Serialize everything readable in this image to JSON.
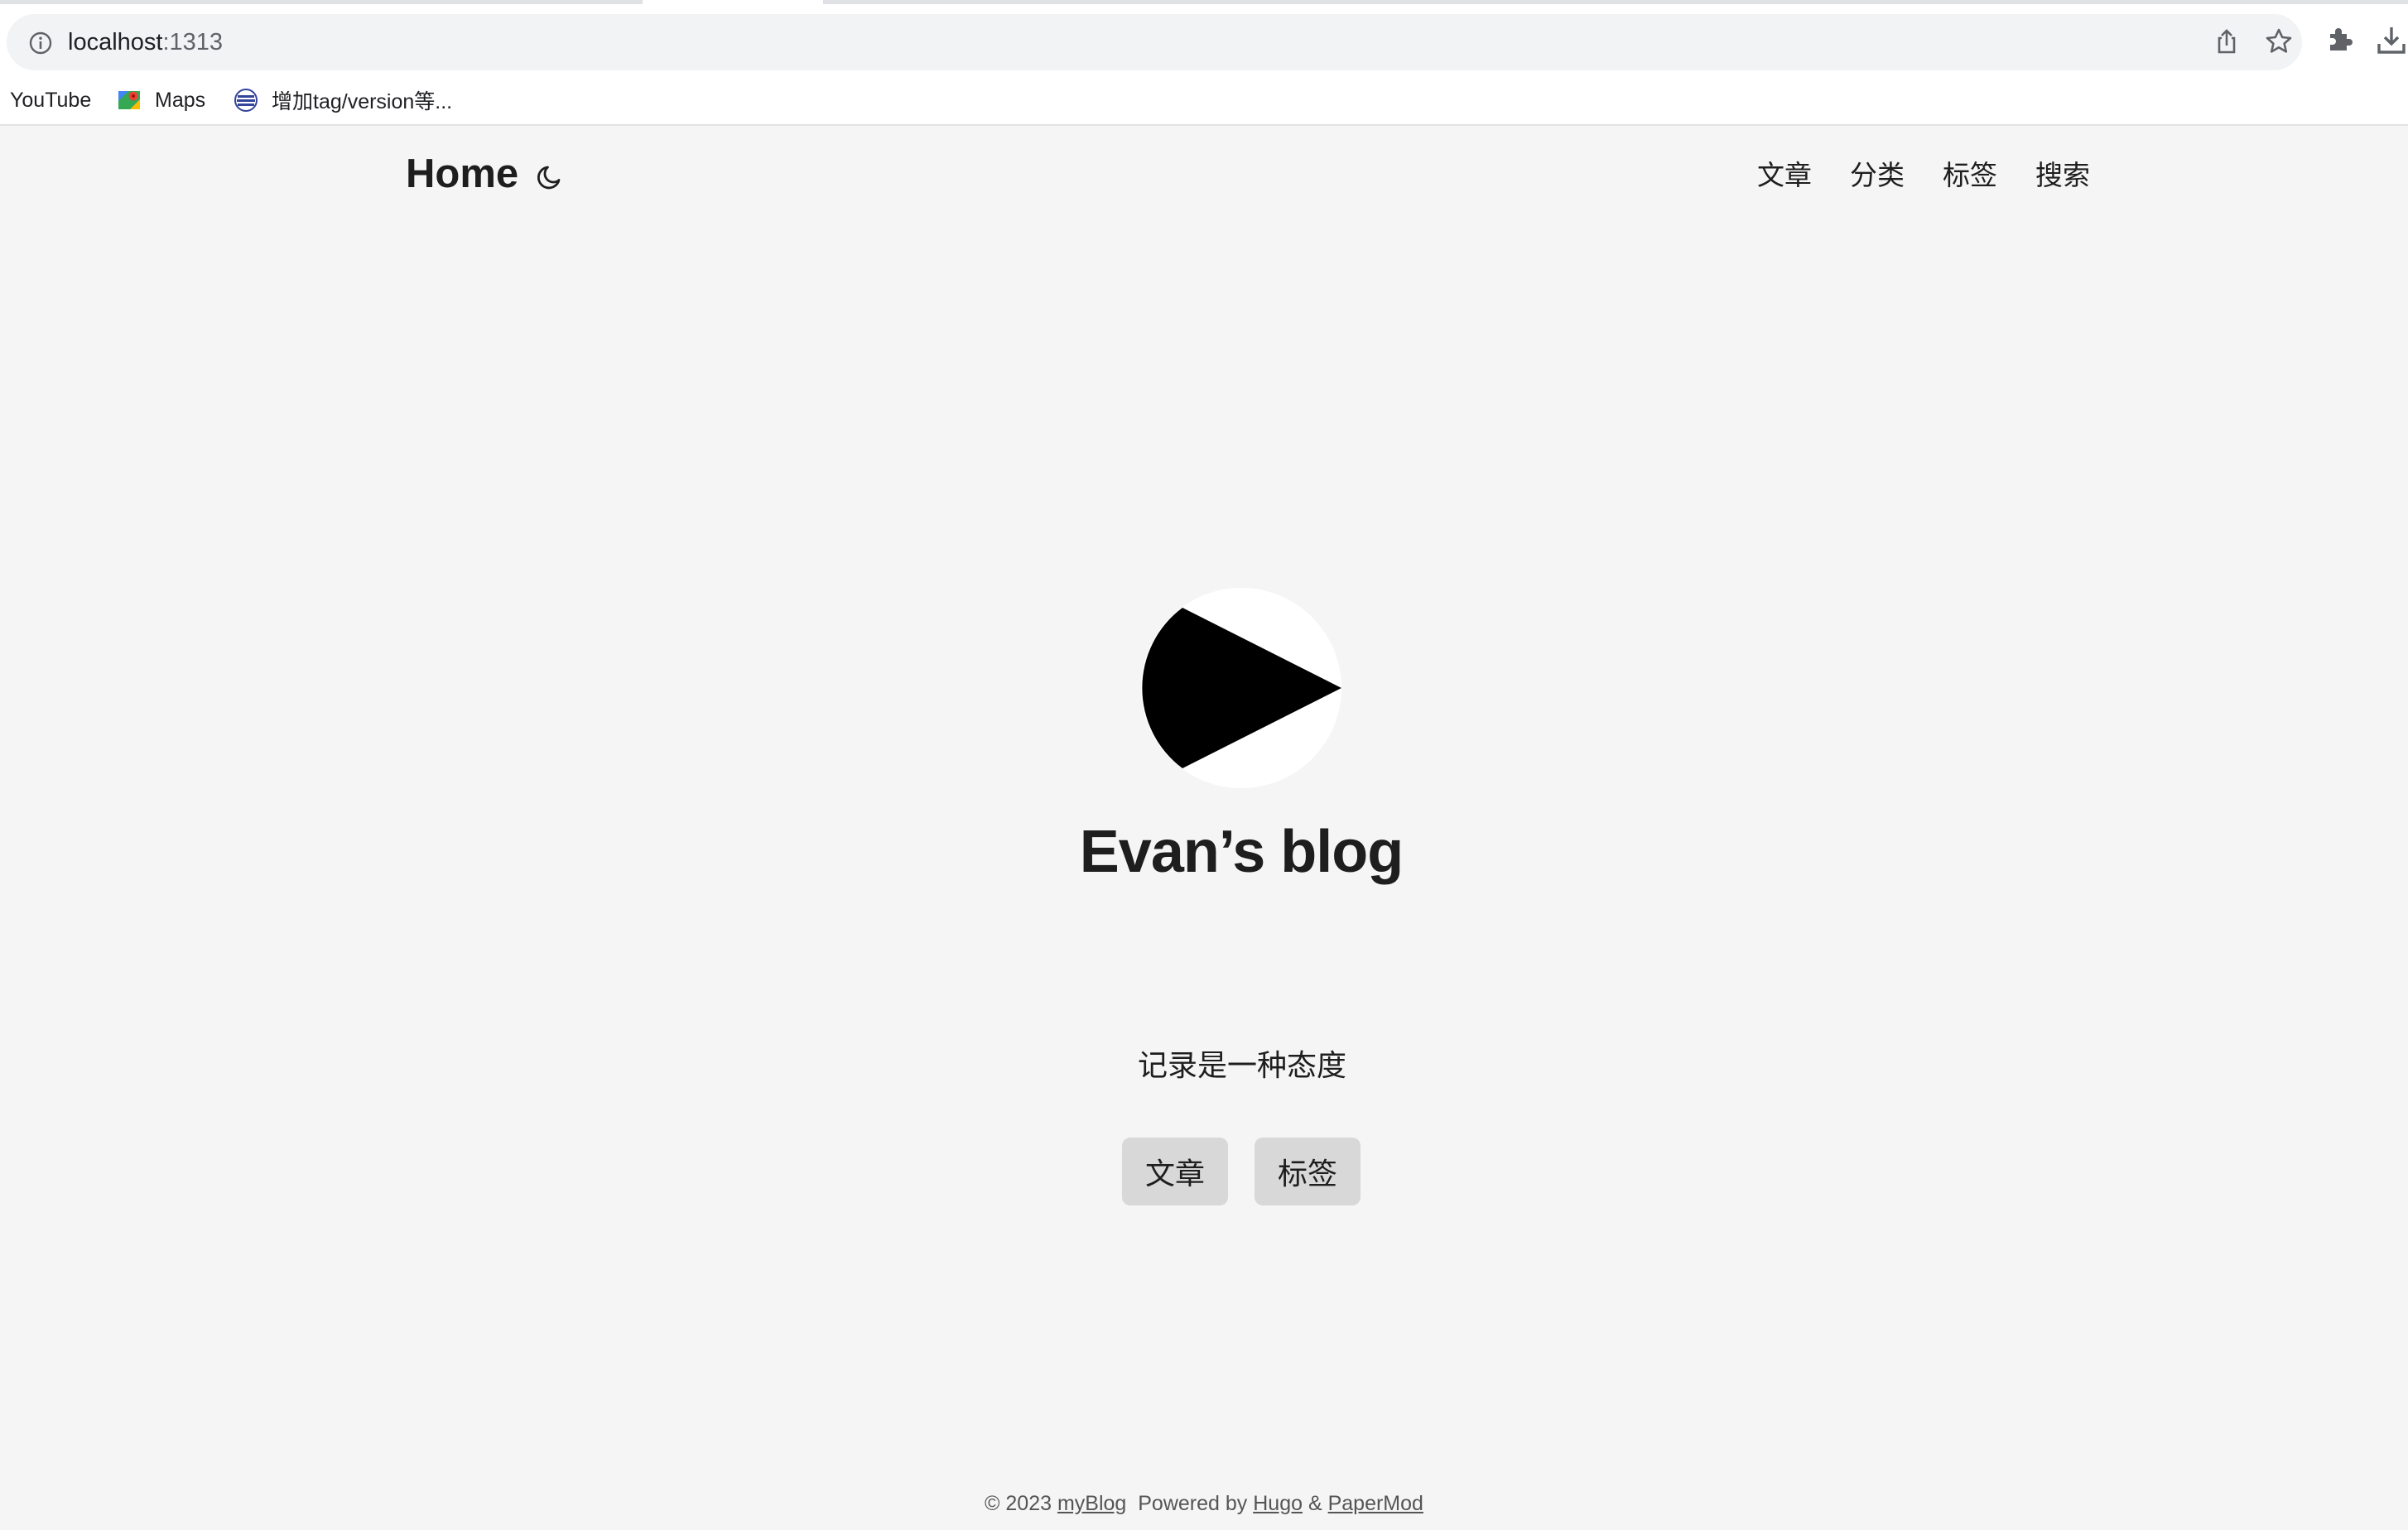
{
  "browser": {
    "url_host": "localhost",
    "url_port": ":1313",
    "bookmarks": [
      {
        "label": "YouTube",
        "icon": "none"
      },
      {
        "label": "Maps",
        "icon": "maps-icon"
      },
      {
        "label": "增加tag/version等...",
        "icon": "site-icon"
      }
    ]
  },
  "header": {
    "logo": "Home",
    "nav": [
      "文章",
      "分类",
      "标签",
      "搜索"
    ]
  },
  "profile": {
    "title": "Evan’s blog",
    "subtitle": "记录是一种态度",
    "buttons": [
      "文章",
      "标签"
    ]
  },
  "footer": {
    "copyright": "© 2023",
    "site_link": "myBlog",
    "powered_by": "Powered by",
    "hugo_link": "Hugo",
    "amp": "&",
    "theme_link": "PaperMod"
  },
  "colors": {
    "page_bg": "#f5f5f5",
    "text": "#1e1e1e",
    "button_bg": "#d8d8d8"
  }
}
